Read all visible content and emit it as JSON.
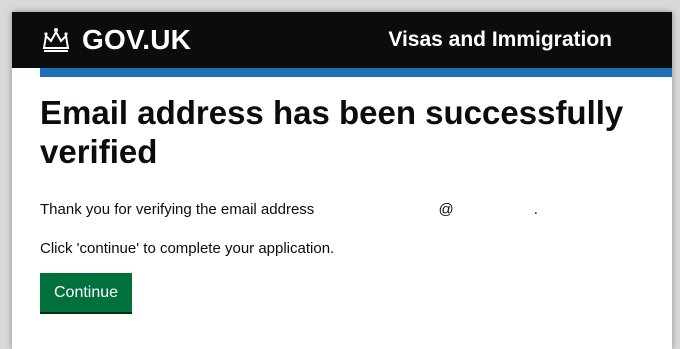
{
  "header": {
    "logo_text": "GOV.UK",
    "service_name": "Visas and Immigration"
  },
  "main": {
    "heading": "Email address has been successfully verified",
    "thanks_text": "Thank you for verifying the email address",
    "email_at": "@",
    "email_end": ".",
    "instruction_text": "Click 'continue' to complete your application.",
    "continue_label": "Continue"
  },
  "colors": {
    "header_bg": "#0b0c0c",
    "accent_blue": "#1d70b8",
    "button_green": "#00703c"
  },
  "icons": {
    "logo": "crown-icon"
  }
}
